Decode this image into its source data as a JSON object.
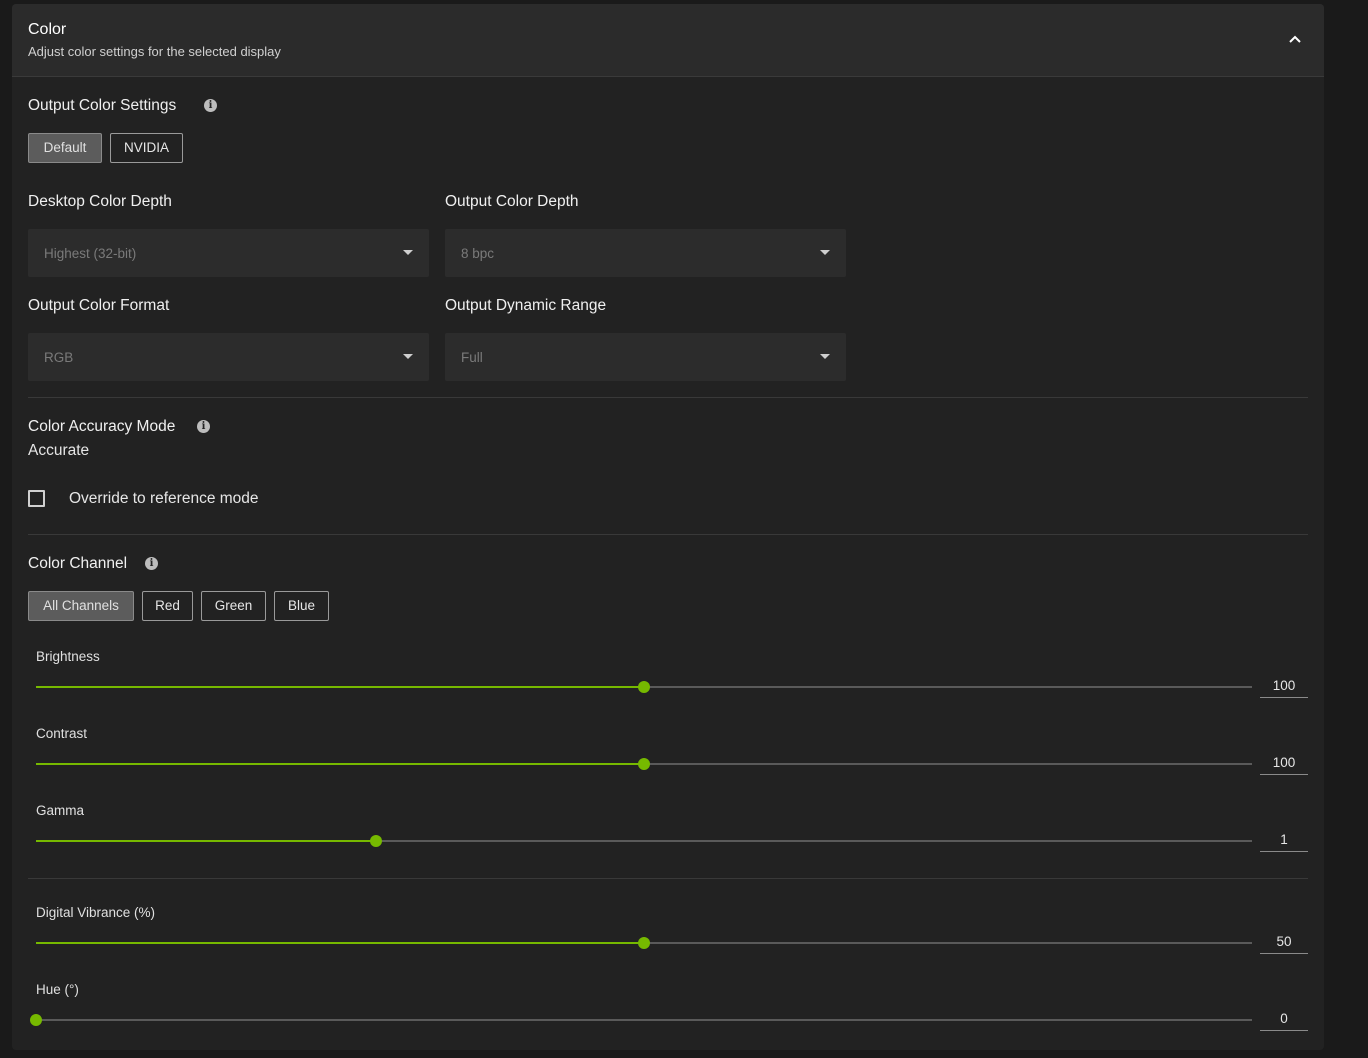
{
  "header": {
    "title": "Color",
    "subtitle": "Adjust color settings for the selected display"
  },
  "output_color_settings": {
    "label": "Output Color Settings",
    "options": [
      "Default",
      "NVIDIA"
    ],
    "selected": "Default"
  },
  "fields": {
    "desktop_color_depth": {
      "label": "Desktop Color Depth",
      "value": "Highest (32-bit)"
    },
    "output_color_depth": {
      "label": "Output Color Depth",
      "value": "8 bpc"
    },
    "output_color_format": {
      "label": "Output Color Format",
      "value": "RGB"
    },
    "output_dynamic_range": {
      "label": "Output Dynamic Range",
      "value": "Full"
    }
  },
  "color_accuracy": {
    "label": "Color Accuracy Mode",
    "value": "Accurate",
    "override_label": "Override to reference mode",
    "override_checked": false
  },
  "color_channel": {
    "label": "Color Channel",
    "options": [
      "All Channels",
      "Red",
      "Green",
      "Blue"
    ],
    "selected": "All Channels"
  },
  "sliders": {
    "brightness": {
      "label": "Brightness",
      "value": "100",
      "fraction": 0.5
    },
    "contrast": {
      "label": "Contrast",
      "value": "100",
      "fraction": 0.5
    },
    "gamma": {
      "label": "Gamma",
      "value": "1",
      "fraction": 0.28
    },
    "digital_vibrance": {
      "label": "Digital Vibrance (%)",
      "value": "50",
      "fraction": 0.5
    },
    "hue": {
      "label": "Hue (°)",
      "value": "0",
      "fraction": 0.0
    }
  },
  "colors": {
    "accent": "#76b900",
    "panel": "#222222",
    "header": "#2b2b2b"
  }
}
